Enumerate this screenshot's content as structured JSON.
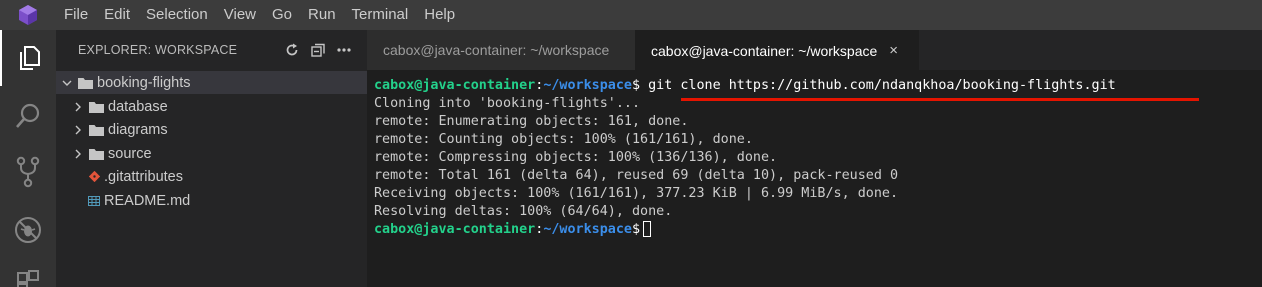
{
  "menu": {
    "items": [
      "File",
      "Edit",
      "Selection",
      "View",
      "Go",
      "Run",
      "Terminal",
      "Help"
    ]
  },
  "activity_bar": {
    "icons": [
      "explorer-icon",
      "search-icon",
      "source-control-icon",
      "debug-icon",
      "extensions-icon"
    ]
  },
  "sidebar": {
    "title": "EXPLORER: WORKSPACE",
    "tree": [
      {
        "label": "booking-flights",
        "type": "folder",
        "expanded": true,
        "depth": 0
      },
      {
        "label": "database",
        "type": "folder",
        "expanded": false,
        "depth": 1
      },
      {
        "label": "diagrams",
        "type": "folder",
        "expanded": false,
        "depth": 1
      },
      {
        "label": "source",
        "type": "folder",
        "expanded": false,
        "depth": 1
      },
      {
        "label": ".gitattributes",
        "type": "file",
        "icon": "git-icon",
        "depth": 1
      },
      {
        "label": "README.md",
        "type": "file",
        "icon": "markdown-icon",
        "depth": 1
      }
    ]
  },
  "tabs": [
    {
      "label": "cabox@java-container: ~/workspace",
      "active": false
    },
    {
      "label": "cabox@java-container: ~/workspace",
      "active": true,
      "close": "×"
    }
  ],
  "terminal": {
    "prompt_user": "cabox@java-container",
    "prompt_colon": ":",
    "prompt_path": "~/workspace",
    "prompt_sign": "$",
    "command": " git clone https://github.com/ndanqkhoa/booking-flights.git",
    "output": [
      "Cloning into 'booking-flights'...",
      "remote: Enumerating objects: 161, done.",
      "remote: Counting objects: 100% (161/161), done.",
      "remote: Compressing objects: 100% (136/136), done.",
      "remote: Total 161 (delta 64), reused 69 (delta 10), pack-reused 0",
      "Receiving objects: 100% (161/161), 377.23 KiB | 6.99 MiB/s, done.",
      "Resolving deltas: 100% (64/64), done."
    ]
  },
  "colors": {
    "prompt_user": "#23d18b",
    "prompt_path": "#3b8eea",
    "annotation_underline": "#e51400"
  }
}
